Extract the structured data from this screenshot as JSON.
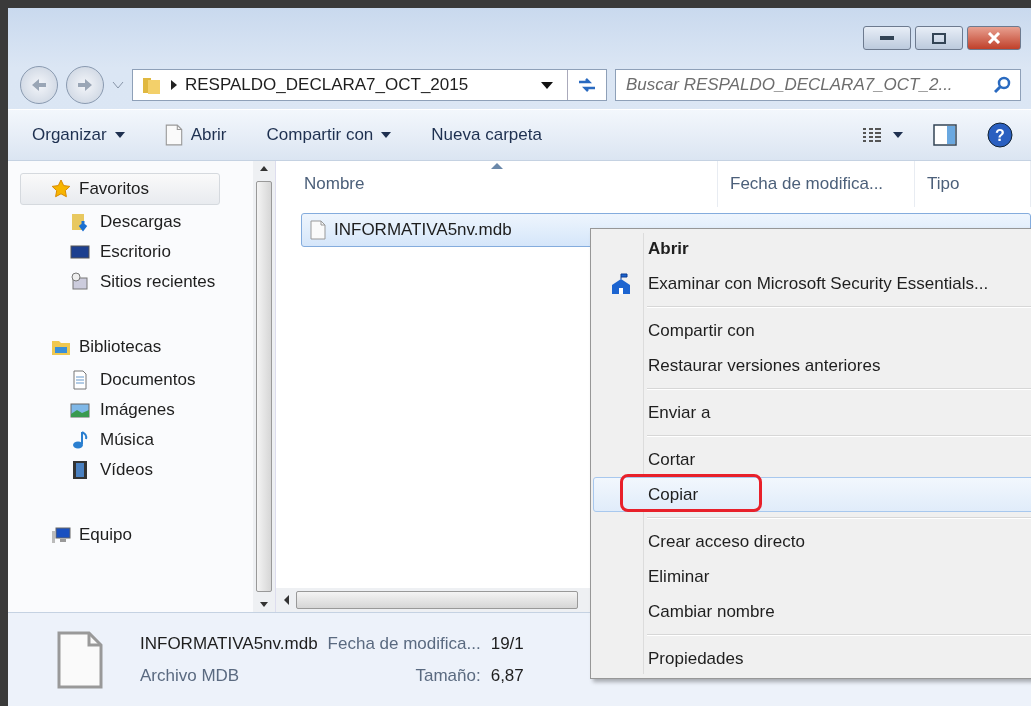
{
  "address": {
    "path": "RESPALDO_DECLARA7_OCT_2015"
  },
  "search": {
    "placeholder": "Buscar RESPALDO_DECLARA7_OCT_2..."
  },
  "toolbar": [
    {
      "label": "Organizar",
      "dropdown": true,
      "icon": false
    },
    {
      "label": "Abrir",
      "dropdown": false,
      "icon": true
    },
    {
      "label": "Compartir con",
      "dropdown": true,
      "icon": false
    },
    {
      "label": "Nueva carpeta",
      "dropdown": false,
      "icon": false
    }
  ],
  "sidebar": {
    "groups": [
      {
        "label": "Favoritos",
        "kind": "star",
        "selected": true,
        "children": [
          {
            "label": "Descargas",
            "kind": "downloads"
          },
          {
            "label": "Escritorio",
            "kind": "desktop"
          },
          {
            "label": "Sitios recientes",
            "kind": "recent"
          }
        ]
      },
      {
        "label": "Bibliotecas",
        "kind": "library",
        "selected": false,
        "children": [
          {
            "label": "Documentos",
            "kind": "documents"
          },
          {
            "label": "Imágenes",
            "kind": "pictures"
          },
          {
            "label": "Música",
            "kind": "music"
          },
          {
            "label": "Vídeos",
            "kind": "videos"
          }
        ]
      },
      {
        "label": "Equipo",
        "kind": "computer",
        "selected": false
      }
    ]
  },
  "help": {
    "label": "?"
  },
  "table": {
    "columns": [
      {
        "label": "Nombre",
        "sorted": true
      },
      {
        "label": "Fecha de modifica...",
        "sorted": false
      },
      {
        "label": "Tipo",
        "sorted": false
      }
    ],
    "rows": [
      {
        "name": "INFORMATIVA5nv.mdb",
        "selected": true
      }
    ]
  },
  "context_menu": {
    "groups": [
      [
        {
          "label": "Abrir",
          "bold": true,
          "icon": false,
          "highlighted": false,
          "circled": false
        },
        {
          "label": "Examinar con Microsoft Security Essentials...",
          "bold": false,
          "icon": true,
          "highlighted": false,
          "circled": false
        }
      ],
      [
        {
          "label": "Compartir con",
          "bold": false,
          "icon": false,
          "highlighted": false,
          "circled": false
        },
        {
          "label": "Restaurar versiones anteriores",
          "bold": false,
          "icon": false,
          "highlighted": false,
          "circled": false
        }
      ],
      [
        {
          "label": "Enviar a",
          "bold": false,
          "icon": false,
          "highlighted": false,
          "circled": false
        }
      ],
      [
        {
          "label": "Cortar",
          "bold": false,
          "icon": false,
          "highlighted": false,
          "circled": false
        },
        {
          "label": "Copiar",
          "bold": false,
          "icon": false,
          "highlighted": true,
          "circled": true
        }
      ],
      [
        {
          "label": "Crear acceso directo",
          "bold": false,
          "icon": false,
          "highlighted": false,
          "circled": false
        },
        {
          "label": "Eliminar",
          "bold": false,
          "icon": false,
          "highlighted": false,
          "circled": false
        },
        {
          "label": "Cambiar nombre",
          "bold": false,
          "icon": false,
          "highlighted": false,
          "circled": false
        }
      ],
      [
        {
          "label": "Propiedades",
          "bold": false,
          "icon": false,
          "highlighted": false,
          "circled": false
        }
      ]
    ]
  },
  "details": {
    "name": "INFORMATIVA5nv.mdb",
    "type": "Archivo MDB",
    "fields": [
      {
        "label": "Fecha de modifica...",
        "value": "19/1"
      },
      {
        "label": "Tamaño:",
        "value": "6,87"
      }
    ]
  }
}
